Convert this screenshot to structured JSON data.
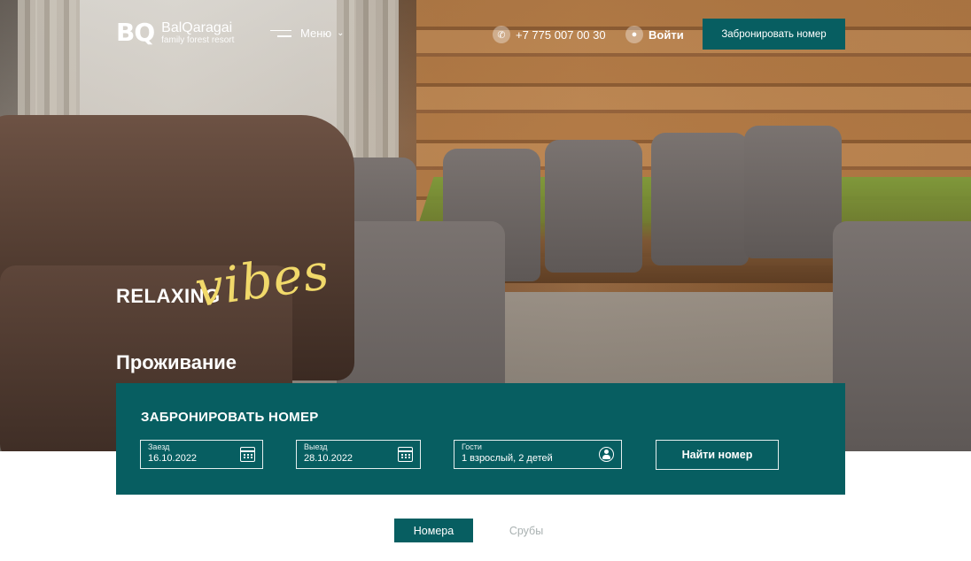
{
  "header": {
    "logo_mark": "BQ",
    "logo_name": "BalQaragai",
    "logo_sub": "family forest resort",
    "menu_label": "Меню",
    "phone": "+7 775 007 00 30",
    "login_label": "Войти",
    "book_button": "Забронировать номер"
  },
  "hero": {
    "relaxing": "RELAXING",
    "vibes": "vibes",
    "title": "Проживание"
  },
  "booking": {
    "title": "ЗАБРОНИРОВАТЬ НОМЕР",
    "checkin": {
      "label": "Заезд",
      "value": "16.10.2022",
      "icon": "calendar-icon"
    },
    "checkout": {
      "label": "Выезд",
      "value": "28.10.2022",
      "icon": "calendar-icon"
    },
    "guests": {
      "label": "Гости",
      "value": "1 взрослый, 2 детей",
      "icon": "user-icon"
    },
    "find_button": "Найти номер"
  },
  "tabs": [
    {
      "label": "Номера",
      "active": true
    },
    {
      "label": "Срубы",
      "active": false
    }
  ],
  "colors": {
    "brand": "#075e61",
    "accent_script": "#f1d96a",
    "inactive_tab": "#a9b1b1"
  }
}
